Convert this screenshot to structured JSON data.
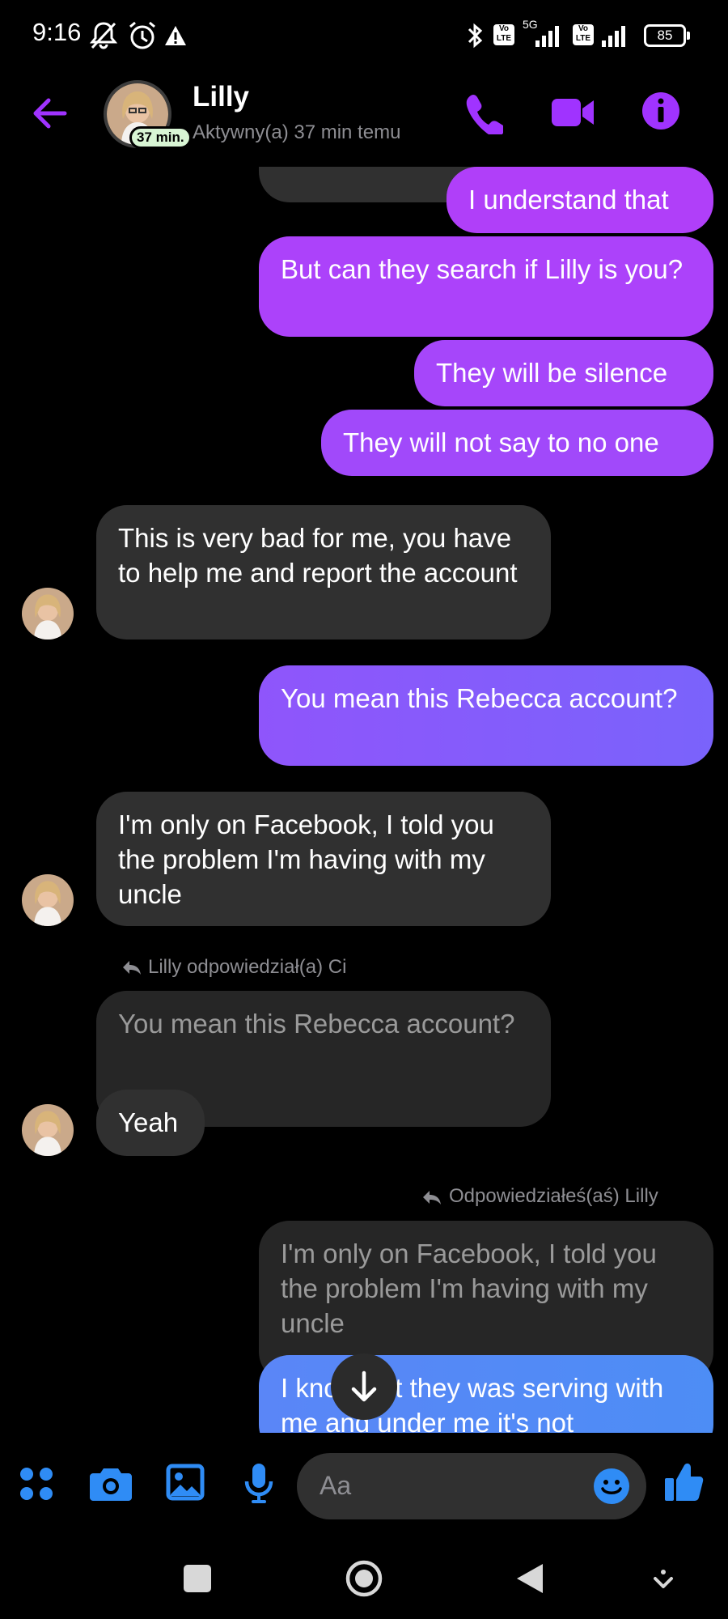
{
  "status_bar": {
    "time": "9:16",
    "battery": "85",
    "network": "5G",
    "volte_1": "Vo LTE",
    "volte_2": "Vo LTE"
  },
  "header": {
    "name": "Lilly",
    "active_badge": "37 min.",
    "status": "Aktywny(a) 37 min temu"
  },
  "messages": {
    "m1": "I understand that",
    "m2": "But can they search if Lilly is you?",
    "m3": "They will be silence",
    "m4": "They will not say to no one",
    "m5": "This is very bad for me, you have to help me and report the account",
    "m6": "You mean this Rebecca account?",
    "m7": "I'm only on Facebook, I told you the problem I'm having with my uncle",
    "reply_label_1": "Lilly odpowiedział(a) Ci",
    "quoted_1": "You mean this Rebecca account?",
    "m8": "Yeah",
    "reply_label_2": "Odpowiedziałeś(aś) Lilly",
    "quoted_2": "I'm only on Facebook, I told you the problem I'm having with my uncle",
    "m9": "I know but they was serving with me and under me it's not"
  },
  "composer": {
    "placeholder": "Aa"
  },
  "colors": {
    "accent": "#a033ff",
    "outgoing_top": "#b13ff9",
    "outgoing_mid": "#8a5cfb",
    "outgoing_bottom": "#4f8cf5",
    "composer_blue": "#2f8cf5",
    "incoming": "#303030"
  }
}
